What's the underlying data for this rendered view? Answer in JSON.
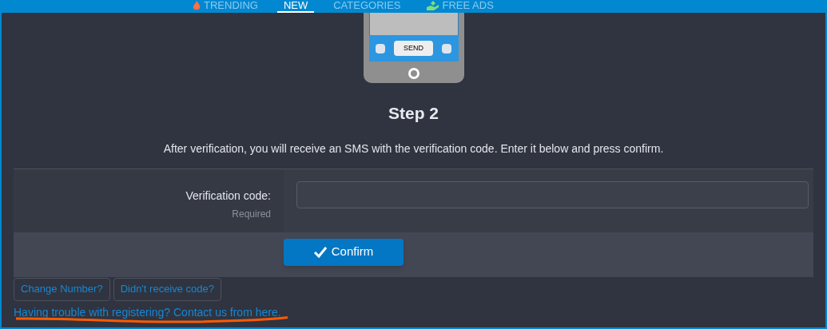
{
  "nav": {
    "items": [
      {
        "label": "TRENDING",
        "kind": "flame",
        "selected": false
      },
      {
        "label": "NEW",
        "kind": "plain",
        "selected": true
      },
      {
        "label": "CATEGORIES",
        "kind": "plain",
        "selected": false
      },
      {
        "label": "FREE ADS",
        "kind": "hand",
        "selected": false
      }
    ]
  },
  "illustration": {
    "button_label": "SEND"
  },
  "step": {
    "title": "Step 2",
    "instructions": "After verification, you will receive an SMS with the verification code. Enter it below and press confirm."
  },
  "form": {
    "label": "Verification code:",
    "hint": "Required"
  },
  "confirm_button": "Confirm",
  "secondary_buttons": [
    "Change Number?",
    "Didn't receive code?"
  ],
  "help_link": "Having trouble with registering? Contact us from here."
}
